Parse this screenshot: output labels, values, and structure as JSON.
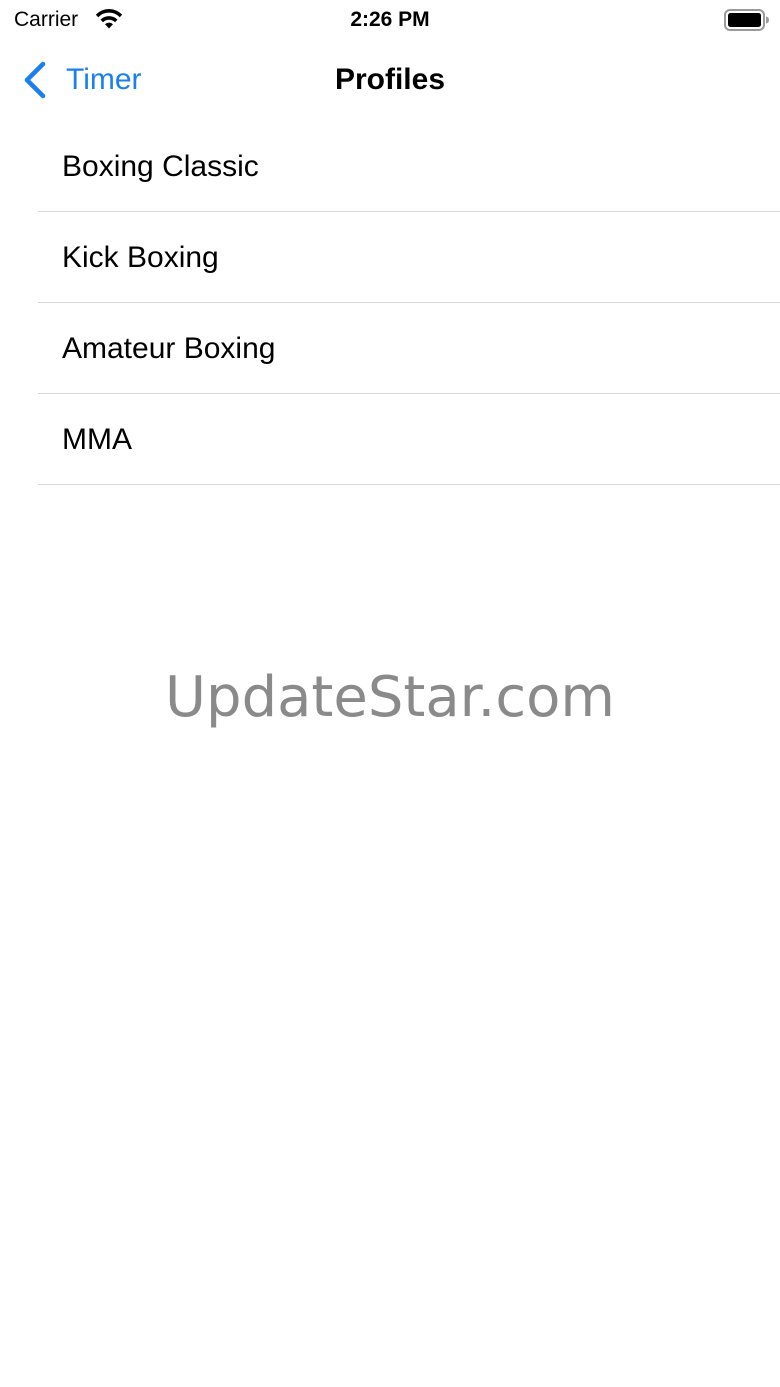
{
  "status_bar": {
    "carrier": "Carrier",
    "time": "2:26 PM",
    "icons": [
      "wifi-icon",
      "battery-icon"
    ]
  },
  "nav": {
    "back_label": "Timer",
    "title": "Profiles",
    "accent_color": "#1a7ff2"
  },
  "profiles": [
    {
      "label": "Boxing Classic"
    },
    {
      "label": "Kick Boxing"
    },
    {
      "label": "Amateur Boxing"
    },
    {
      "label": "MMA"
    }
  ],
  "watermark": "UpdateStar.com"
}
